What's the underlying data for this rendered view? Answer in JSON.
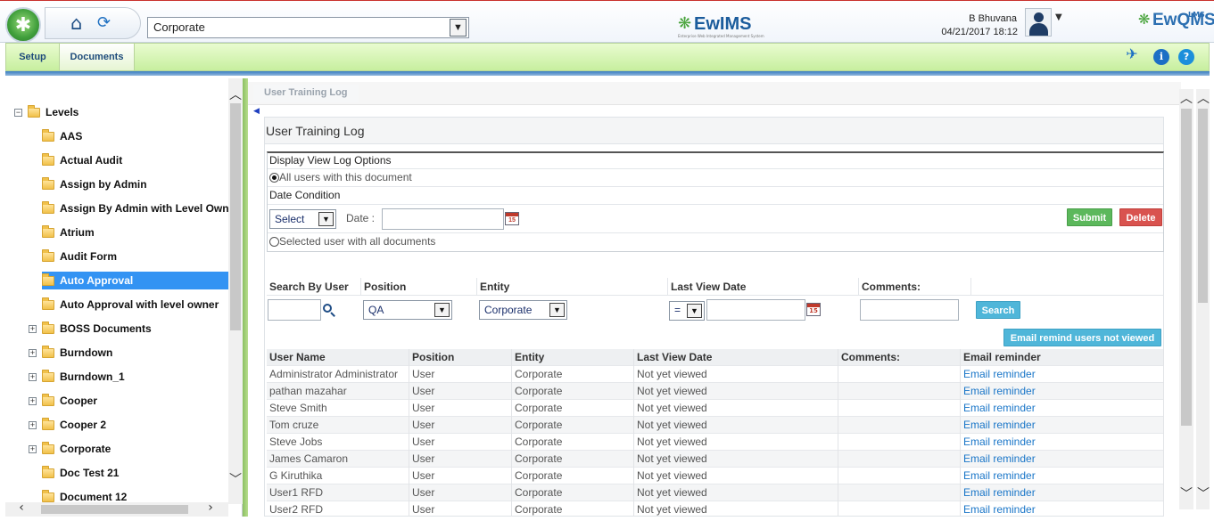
{
  "header": {
    "entity_selected": "Corporate",
    "brand_center": "EwIMS",
    "brand_center_tagline": "Enterprise Web Integrated Management System",
    "user_name": "B Bhuvana",
    "user_datetime": "04/21/2017 18:12",
    "brand_right": "EwQMS",
    "brand_right_sup": "LMS",
    "icons": [
      "home-icon",
      "refresh-icon",
      "user-avatar",
      "pin-icon",
      "info-icon",
      "help-icon"
    ]
  },
  "menu": {
    "setup": "Setup",
    "documents": "Documents"
  },
  "tree": {
    "root": "Levels",
    "items": [
      {
        "label": "AAS",
        "expandable": false
      },
      {
        "label": "Actual Audit",
        "expandable": false
      },
      {
        "label": "Assign by Admin",
        "expandable": false
      },
      {
        "label": "Assign By Admin with Level Owner",
        "expandable": false
      },
      {
        "label": "Atrium",
        "expandable": false
      },
      {
        "label": "Audit Form",
        "expandable": false
      },
      {
        "label": "Auto Approval",
        "expandable": false,
        "selected": true
      },
      {
        "label": "Auto Approval with level owner",
        "expandable": false
      },
      {
        "label": "BOSS Documents",
        "expandable": true
      },
      {
        "label": "Burndown",
        "expandable": true
      },
      {
        "label": "Burndown_1",
        "expandable": true
      },
      {
        "label": "Cooper",
        "expandable": true
      },
      {
        "label": "Cooper 2",
        "expandable": true
      },
      {
        "label": "Corporate",
        "expandable": true
      },
      {
        "label": "Doc Test 21",
        "expandable": false
      },
      {
        "label": "Document 12",
        "expandable": false
      }
    ]
  },
  "main": {
    "breadcrumb": "User Training Log",
    "title": "User Training Log",
    "options": {
      "heading": "Display View Log Options",
      "option_all": "All users with this document",
      "date_condition": "Date Condition",
      "select_value": "Select",
      "date_label": "Date :",
      "date_value": "",
      "option_selected": "Selected user with all documents",
      "submit": "Submit",
      "delete": "Delete"
    },
    "filters": {
      "headers": [
        "Search By User",
        "Position",
        "Entity",
        "Last View Date",
        "Comments:"
      ],
      "search_user_value": "",
      "position_value": "QA",
      "entity_value": "Corporate",
      "operator_value": "=",
      "last_view_value": "",
      "comments_value": "",
      "search_button": "Search",
      "email_remind_button": "Email remind users not viewed"
    },
    "grid": {
      "columns": [
        "User Name",
        "Position",
        "Entity",
        "Last View Date",
        "Comments:",
        "Email reminder"
      ],
      "rows": [
        [
          "Administrator Administrator",
          "User",
          "Corporate",
          "Not yet viewed",
          "",
          "Email reminder"
        ],
        [
          "pathan mazahar",
          "User",
          "Corporate",
          "Not yet viewed",
          "",
          "Email reminder"
        ],
        [
          "Steve Smith",
          "User",
          "Corporate",
          "Not yet viewed",
          "",
          "Email reminder"
        ],
        [
          "Tom cruze",
          "User",
          "Corporate",
          "Not yet viewed",
          "",
          "Email reminder"
        ],
        [
          "Steve Jobs",
          "User",
          "Corporate",
          "Not yet viewed",
          "",
          "Email reminder"
        ],
        [
          "James Camaron",
          "User",
          "Corporate",
          "Not yet viewed",
          "",
          "Email reminder"
        ],
        [
          "G Kiruthika",
          "User",
          "Corporate",
          "Not yet viewed",
          "",
          "Email reminder"
        ],
        [
          "User1 RFD",
          "User",
          "Corporate",
          "Not yet viewed",
          "",
          "Email reminder"
        ],
        [
          "User2 RFD",
          "User",
          "Corporate",
          "Not yet viewed",
          "",
          "Email reminder"
        ]
      ]
    }
  },
  "colors": {
    "menu_green": "#c7ef9f",
    "selected_blue": "#3393f3",
    "submit_green": "#5cb85c",
    "delete_red": "#d9534f",
    "search_blue": "#4fb6d9",
    "link_blue": "#1a76c8"
  }
}
